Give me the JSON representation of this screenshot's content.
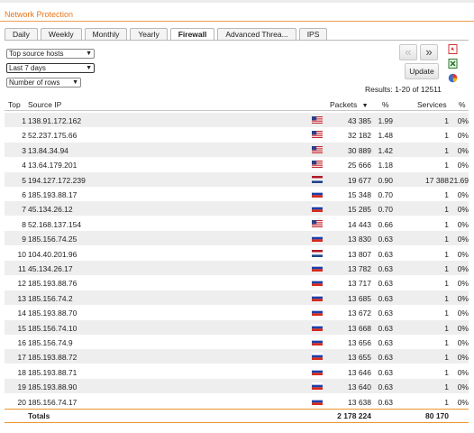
{
  "panel": {
    "title": "Network Protection"
  },
  "tabs": [
    {
      "label": "Daily"
    },
    {
      "label": "Weekly"
    },
    {
      "label": "Monthly"
    },
    {
      "label": "Yearly"
    },
    {
      "label": "Firewall",
      "active": true
    },
    {
      "label": "Advanced Threa..."
    },
    {
      "label": "IPS"
    }
  ],
  "filters": {
    "report": "Top source hosts",
    "range": "Last 7 days",
    "rows": "Number of rows"
  },
  "controls": {
    "prev": "«",
    "next": "»",
    "update": "Update",
    "results": "Results: 1-20 of 12511"
  },
  "icons": [
    "pdf-icon",
    "excel-icon",
    "pie-chart-icon"
  ],
  "table": {
    "headers": {
      "top": "Top",
      "source_ip": "Source IP",
      "packets": "Packets",
      "pct1": "%",
      "services": "Services",
      "pct2": "%"
    },
    "rows": [
      {
        "top": "1",
        "ip": "138.91.172.162",
        "flag": "us",
        "packets": "43 385",
        "pct": "1.99",
        "services": "1",
        "spct": "0%"
      },
      {
        "top": "2",
        "ip": "52.237.175.66",
        "flag": "us",
        "packets": "32 182",
        "pct": "1.48",
        "services": "1",
        "spct": "0%"
      },
      {
        "top": "3",
        "ip": "13.84.34.94",
        "flag": "us",
        "packets": "30 889",
        "pct": "1.42",
        "services": "1",
        "spct": "0%"
      },
      {
        "top": "4",
        "ip": "13.64.179.201",
        "flag": "us",
        "packets": "25 666",
        "pct": "1.18",
        "services": "1",
        "spct": "0%"
      },
      {
        "top": "5",
        "ip": "194.127.172.239",
        "flag": "nl",
        "packets": "19 677",
        "pct": "0.90",
        "services": "17 388",
        "spct": "21.69"
      },
      {
        "top": "6",
        "ip": "185.193.88.17",
        "flag": "ru",
        "packets": "15 348",
        "pct": "0.70",
        "services": "1",
        "spct": "0%"
      },
      {
        "top": "7",
        "ip": "45.134.26.12",
        "flag": "ru",
        "packets": "15 285",
        "pct": "0.70",
        "services": "1",
        "spct": "0%"
      },
      {
        "top": "8",
        "ip": "52.168.137.154",
        "flag": "us",
        "packets": "14 443",
        "pct": "0.66",
        "services": "1",
        "spct": "0%"
      },
      {
        "top": "9",
        "ip": "185.156.74.25",
        "flag": "ru",
        "packets": "13 830",
        "pct": "0.63",
        "services": "1",
        "spct": "0%"
      },
      {
        "top": "10",
        "ip": "104.40.201.96",
        "flag": "nl",
        "packets": "13 807",
        "pct": "0.63",
        "services": "1",
        "spct": "0%"
      },
      {
        "top": "11",
        "ip": "45.134.26.17",
        "flag": "ru",
        "packets": "13 782",
        "pct": "0.63",
        "services": "1",
        "spct": "0%"
      },
      {
        "top": "12",
        "ip": "185.193.88.76",
        "flag": "ru",
        "packets": "13 717",
        "pct": "0.63",
        "services": "1",
        "spct": "0%"
      },
      {
        "top": "13",
        "ip": "185.156.74.2",
        "flag": "ru",
        "packets": "13 685",
        "pct": "0.63",
        "services": "1",
        "spct": "0%"
      },
      {
        "top": "14",
        "ip": "185.193.88.70",
        "flag": "ru",
        "packets": "13 672",
        "pct": "0.63",
        "services": "1",
        "spct": "0%"
      },
      {
        "top": "15",
        "ip": "185.156.74.10",
        "flag": "ru",
        "packets": "13 668",
        "pct": "0.63",
        "services": "1",
        "spct": "0%"
      },
      {
        "top": "16",
        "ip": "185.156.74.9",
        "flag": "ru",
        "packets": "13 656",
        "pct": "0.63",
        "services": "1",
        "spct": "0%"
      },
      {
        "top": "17",
        "ip": "185.193.88.72",
        "flag": "ru",
        "packets": "13 655",
        "pct": "0.63",
        "services": "1",
        "spct": "0%"
      },
      {
        "top": "18",
        "ip": "185.193.88.71",
        "flag": "ru",
        "packets": "13 646",
        "pct": "0.63",
        "services": "1",
        "spct": "0%"
      },
      {
        "top": "19",
        "ip": "185.193.88.90",
        "flag": "ru",
        "packets": "13 640",
        "pct": "0.63",
        "services": "1",
        "spct": "0%"
      },
      {
        "top": "20",
        "ip": "185.156.74.17",
        "flag": "ru",
        "packets": "13 638",
        "pct": "0.63",
        "services": "1",
        "spct": "0%"
      }
    ],
    "totals": {
      "label": "Totals",
      "packets": "2 178 224",
      "services": "80 170"
    }
  },
  "colors": {
    "accent": "#e8751a",
    "row_alt": "#eeeeee"
  }
}
